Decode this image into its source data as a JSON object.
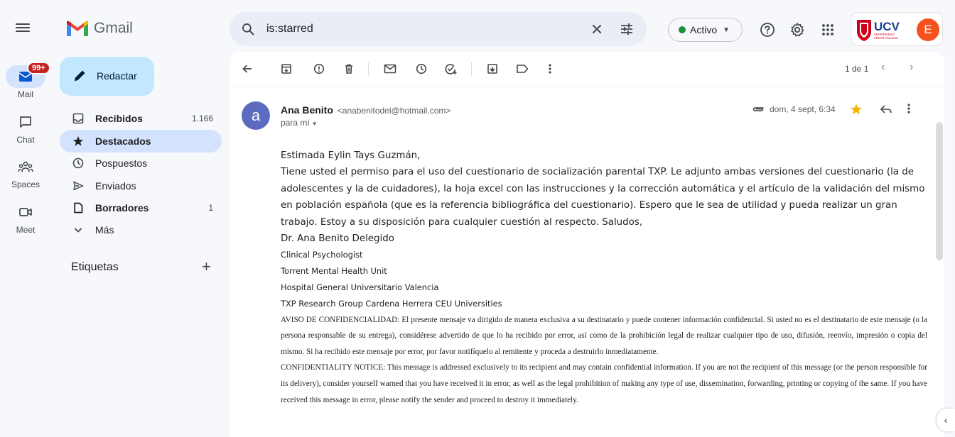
{
  "app": {
    "name": "Gmail"
  },
  "search": {
    "query": "is:starred"
  },
  "status": {
    "label": "Activo",
    "color": "#1e8e3e"
  },
  "account": {
    "avatar_letter": "E",
    "org_name": "UCV",
    "org_subtitle": "UNIVERSIDAD CÉSAR VALLEJO",
    "avatar_color": "#f4511e"
  },
  "rail": {
    "items": [
      {
        "label": "Mail",
        "badge": "99+",
        "icon": "mail-icon"
      },
      {
        "label": "Chat",
        "icon": "chat-icon"
      },
      {
        "label": "Spaces",
        "icon": "spaces-icon"
      },
      {
        "label": "Meet",
        "icon": "meet-icon"
      }
    ]
  },
  "sidebar": {
    "compose_label": "Redactar",
    "items": [
      {
        "label": "Recibidos",
        "count": "1.166",
        "icon": "inbox-icon"
      },
      {
        "label": "Destacados",
        "count": "",
        "icon": "star-icon"
      },
      {
        "label": "Pospuestos",
        "count": "",
        "icon": "clock-icon"
      },
      {
        "label": "Enviados",
        "count": "",
        "icon": "send-icon"
      },
      {
        "label": "Borradores",
        "count": "1",
        "icon": "draft-icon"
      },
      {
        "label": "Más",
        "count": "",
        "icon": "chevron-down-icon"
      }
    ],
    "labels_heading": "Etiquetas"
  },
  "toolbar": {
    "pager": "1 de 1"
  },
  "message": {
    "avatar_letter": "a",
    "avatar_color": "#5c6bc0",
    "sender_name": "Ana Benito",
    "sender_email": "<anabenitodel@hotmail.com>",
    "recipient": "para mí",
    "date": "dom, 4 sept, 6:34",
    "greeting": "Estimada Eylin Tays Guzmán,",
    "paragraph": "Tiene usted el permiso para el uso del cuestionario de socialización parental TXP. Le adjunto ambas versiones del cuestionario (la de adolescentes y la de cuidadores), la hoja excel con las instrucciones y la corrección automática y el artículo de la validación del mismo en población española (que es la referencia bibliográfica del cuestionario). Espero que le sea de utilidad y pueda realizar un gran trabajo. Estoy a su disposición para cualquier cuestión al respecto. Saludos,",
    "signature_name": "Dr. Ana Benito Delegido",
    "signature_lines": [
      "Clinical Psychologist",
      "Torrent Mental Health Unit",
      "Hospital General Universitario Valencia",
      "TXP Research Group Cardena Herrera CEU Universities"
    ],
    "notice_es": "AVISO DE CONFIDENCIALIDAD: El presente mensaje va dirigido de manera exclusiva a su destinatario y puede contener información confidencial. Si usted no es el destinatario de este mensaje (o la persona responsable de su entrega), considérese advertido de que lo ha recibido por error, así como de la prohibición legal de realizar cualquier tipo de uso, difusión, reenvío, impresión o copia del mismo. Si ha recibido este mensaje por error, por favor notifíquelo al remitente y proceda a destruirlo inmediatamente.",
    "notice_en": "CONFIDENTIALITY NOTICE: This message is addressed exclusively to its recipient and may contain confidential information. If you are not the recipient of this message (or the person responsible for its delivery), consider yourself warned that you have received it in error, as well as the legal prohibition of making any type of use, dissemination, forwarding, printing or copying of the same. If you have received this message in error, please notify the sender and proceed to destroy it immediately."
  }
}
